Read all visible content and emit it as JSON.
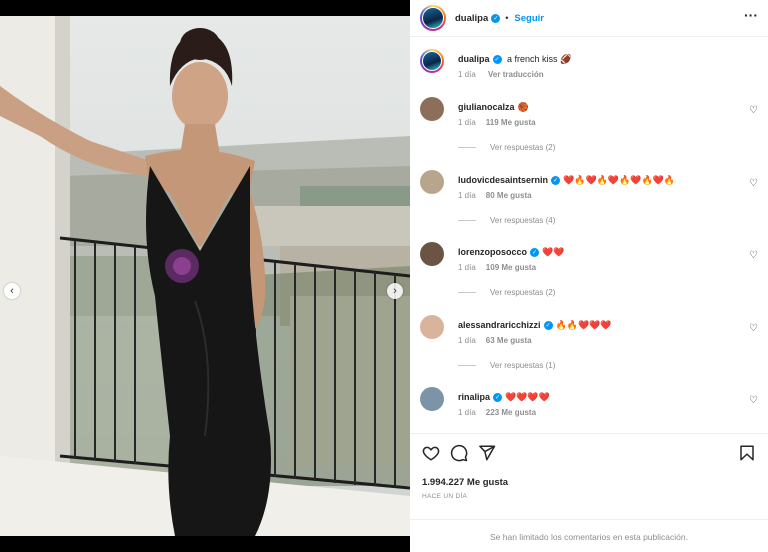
{
  "post": {
    "author": "dualipa",
    "follow_label": "Seguir",
    "caption": "a french kiss",
    "caption_emoji": "🏈",
    "caption_time": "1 día",
    "translate_label": "Ver traducción",
    "likes_label": "1.994.227 Me gusta",
    "posted_ago": "HACE UN DÍA",
    "comments_limited": "Se han limitado los comentarios en esta publicación."
  },
  "comments": [
    {
      "user": "giulianocalza",
      "verified": false,
      "text": "🏀",
      "time": "1 día",
      "likes": "119 Me gusta",
      "replies": "Ver respuestas (2)"
    },
    {
      "user": "ludovicdesaintsernin",
      "verified": true,
      "text": "❤️🔥❤️🔥❤️🔥❤️🔥❤️🔥",
      "time": "1 día",
      "likes": "80 Me gusta",
      "replies": "Ver respuestas (4)"
    },
    {
      "user": "lorenzoposocco",
      "verified": true,
      "text": "❤️❤️",
      "time": "1 día",
      "likes": "109 Me gusta",
      "replies": "Ver respuestas (2)"
    },
    {
      "user": "alessandraricchizzi",
      "verified": true,
      "text": "🔥🔥❤️❤️❤️",
      "time": "1 día",
      "likes": "63 Me gusta",
      "replies": "Ver respuestas (1)"
    },
    {
      "user": "rinalipa",
      "verified": true,
      "text": "❤️❤️❤️❤️",
      "time": "1 día",
      "likes": "223 Me gusta",
      "replies": ""
    }
  ],
  "carousel": {
    "slide_count": 5,
    "active_slide": 3
  },
  "icons": {
    "more": "more-options-icon",
    "like": "heart-icon",
    "comment": "comment-icon",
    "share": "share-icon",
    "save": "bookmark-icon",
    "prev": "chevron-left-icon",
    "next": "chevron-right-icon"
  },
  "colors": {
    "accent": "#0095f6",
    "muted": "#8e8e8e",
    "text": "#262626"
  }
}
